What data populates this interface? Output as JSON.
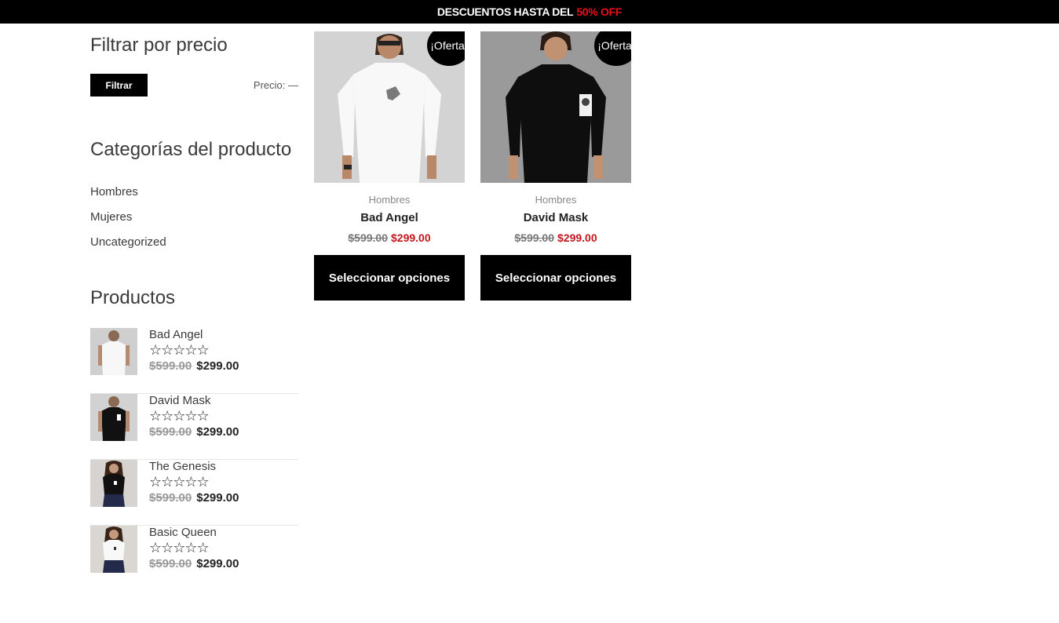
{
  "banner": {
    "text": "DESCUENTOS HASTA DEL",
    "highlight": "50% OFF"
  },
  "colors": {
    "accent": "#e8101a",
    "sale_price": "#c4161c",
    "button": "#000000"
  },
  "sidebar": {
    "filter_title": "Filtrar por precio",
    "filter_button": "Filtrar",
    "price_label": "Precio: —",
    "categories_title": "Categorías del producto",
    "categories": [
      "Hombres",
      "Mujeres",
      "Uncategorized"
    ],
    "products_title": "Productos",
    "products": [
      {
        "name": "Bad Angel",
        "stars": "☆☆☆☆☆",
        "old_price": "$599.00",
        "new_price": "$299.00",
        "thumb": "white-shirt-man"
      },
      {
        "name": "David Mask",
        "stars": "☆☆☆☆☆",
        "old_price": "$599.00",
        "new_price": "$299.00",
        "thumb": "black-shirt-man"
      },
      {
        "name": "The Genesis",
        "stars": "☆☆☆☆☆",
        "old_price": "$599.00",
        "new_price": "$299.00",
        "thumb": "black-shirt-woman"
      },
      {
        "name": "Basic Queen",
        "stars": "☆☆☆☆☆",
        "old_price": "$599.00",
        "new_price": "$299.00",
        "thumb": "white-shirt-woman"
      }
    ]
  },
  "grid": [
    {
      "badge": "¡Oferta!",
      "category": "Hombres",
      "name": "Bad Angel",
      "old_price": "$599.00",
      "new_price": "$299.00",
      "button": "Seleccionar opciones"
    },
    {
      "badge": "¡Oferta!",
      "category": "Hombres",
      "name": "David Mask",
      "old_price": "$599.00",
      "new_price": "$299.00",
      "button": "Seleccionar opciones"
    }
  ]
}
